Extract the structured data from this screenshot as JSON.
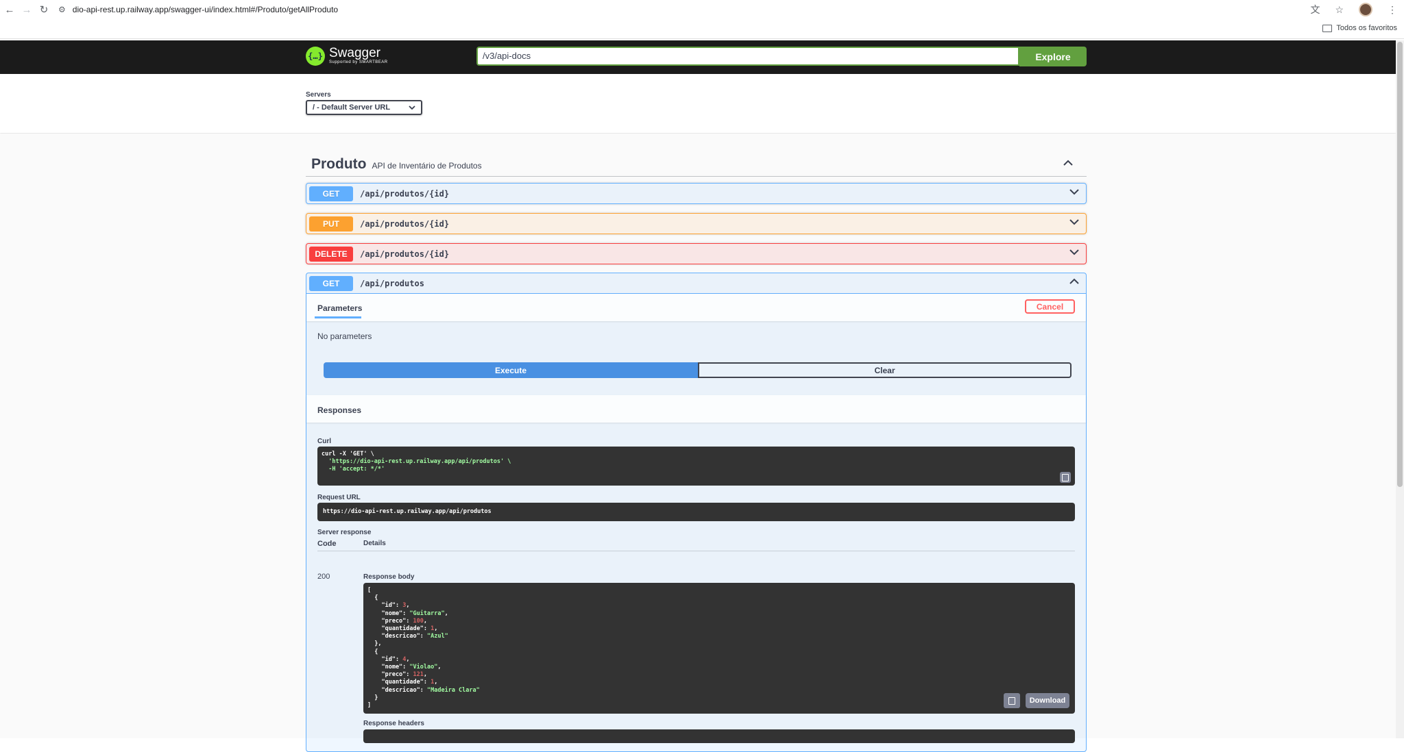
{
  "browser": {
    "url": "dio-api-rest.up.railway.app/swagger-ui/index.html#/Produto/getAllProduto",
    "bookmarks_label": "Todos os favoritos"
  },
  "topbar": {
    "logo_name": "Swagger",
    "logo_sub": "Supported by SMARTBEAR",
    "spec_url": "/v3/api-docs",
    "explore_label": "Explore"
  },
  "servers": {
    "label": "Servers",
    "selected": "/ - Default Server URL"
  },
  "tag": {
    "name": "Produto",
    "description": "API de Inventário de Produtos"
  },
  "operations": [
    {
      "method": "GET",
      "path": "/api/produtos/{id}"
    },
    {
      "method": "PUT",
      "path": "/api/produtos/{id}"
    },
    {
      "method": "DELETE",
      "path": "/api/produtos/{id}"
    }
  ],
  "expanded_op": {
    "method": "GET",
    "path": "/api/produtos",
    "parameters_tab": "Parameters",
    "cancel_label": "Cancel",
    "no_params": "No parameters",
    "execute_label": "Execute",
    "clear_label": "Clear",
    "responses_title": "Responses",
    "curl_label": "Curl",
    "curl_lines": [
      "curl -X 'GET' \\",
      "  'https://dio-api-rest.up.railway.app/api/produtos' \\",
      "  -H 'accept: */*'"
    ],
    "request_url_label": "Request URL",
    "request_url": "https://dio-api-rest.up.railway.app/api/produtos",
    "server_response_label": "Server response",
    "code_col": "Code",
    "details_col": "Details",
    "status_code": "200",
    "response_body_label": "Response body",
    "response_body": [
      {
        "id": 3,
        "nome": "Guitarra",
        "preco": 100,
        "quantidade": 1,
        "descricao": "Azul"
      },
      {
        "id": 4,
        "nome": "Violao",
        "preco": 121,
        "quantidade": 1,
        "descricao": "Madeira Clara"
      }
    ],
    "download_label": "Download",
    "response_headers_label": "Response headers"
  },
  "colors": {
    "get": "#61affe",
    "put": "#fca130",
    "delete": "#f93e3e",
    "execute": "#4990e2",
    "swagger_green": "#62a03f"
  }
}
